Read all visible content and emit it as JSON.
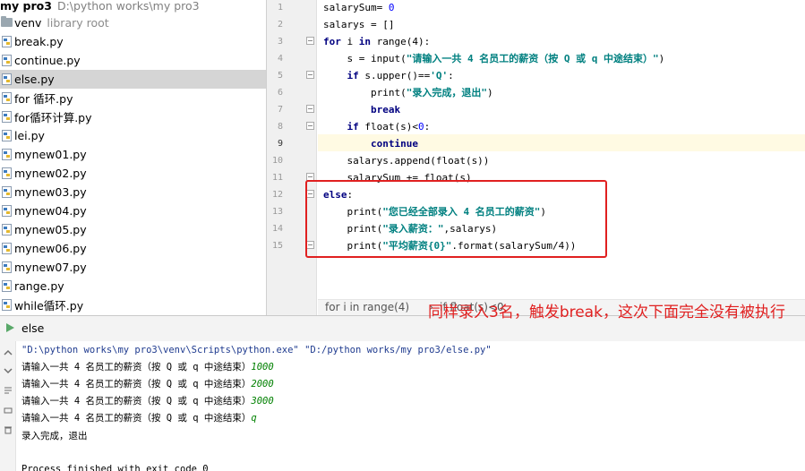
{
  "project": {
    "name": "my pro3",
    "path": "D:\\python works\\my pro3"
  },
  "tree": {
    "venv": {
      "label": "venv",
      "sub": "library root"
    },
    "files": [
      {
        "label": "break.py"
      },
      {
        "label": "continue.py"
      },
      {
        "label": "else.py",
        "selected": true
      },
      {
        "label": "for 循环.py"
      },
      {
        "label": "for循环计算.py"
      },
      {
        "label": "lei.py"
      },
      {
        "label": "mynew01.py"
      },
      {
        "label": "mynew02.py"
      },
      {
        "label": "mynew03.py"
      },
      {
        "label": "mynew04.py"
      },
      {
        "label": "mynew05.py"
      },
      {
        "label": "mynew06.py"
      },
      {
        "label": "mynew07.py"
      },
      {
        "label": "range.py"
      },
      {
        "label": "while循环.py"
      }
    ]
  },
  "editor": {
    "current_line": 9,
    "line_numbers": [
      "1",
      "2",
      "3",
      "4",
      "5",
      "6",
      "7",
      "8",
      "9",
      "10",
      "11",
      "12",
      "13",
      "14",
      "15"
    ]
  },
  "code": {
    "l1": {
      "a": "salarySum= ",
      "b": "0"
    },
    "l2": {
      "a": "salarys = []"
    },
    "l3": {
      "kw1": "for",
      "a": " i ",
      "kw2": "in",
      "b": " range(4):"
    },
    "l4": {
      "a": "    s = input(",
      "str": "\"请输入一共 4 名员工的薪资（按 Q 或 q 中途结束）\"",
      "b": ")"
    },
    "l5": {
      "kw": "    if",
      "a": " s.upper()==",
      "str": "'Q'",
      "b": ":"
    },
    "l6": {
      "a": "        print(",
      "str": "\"录入完成，退出\"",
      "b": ")"
    },
    "l7": {
      "kw": "        break"
    },
    "l8": {
      "kw": "    if",
      "a": " float(s)<",
      "num": "0",
      "b": ":"
    },
    "l9": {
      "kw": "        continue"
    },
    "l10": {
      "a": "    salarys.append(float(s))"
    },
    "l11": {
      "a": "    salarySum += float(s)"
    },
    "l12": {
      "kw": "else",
      "a": ":"
    },
    "l13": {
      "a": "    print(",
      "str": "\"您已经全部录入 4 名员工的薪资\"",
      "b": ")"
    },
    "l14": {
      "a": "    print(",
      "str": "\"录入薪资：\"",
      "b": ",salarys)"
    },
    "l15": {
      "a": "    print(",
      "str": "\"平均薪资{0}\"",
      "b": ".format(salarySum/4))"
    }
  },
  "breadcrumb": {
    "item1": "for i in range(4)",
    "item2": "if float(s)<0"
  },
  "run": {
    "tab_label": "else",
    "command": "\"D:\\python works\\my pro3\\venv\\Scripts\\python.exe\" \"D:/python works/my pro3/else.py\"",
    "prompt": "请输入一共 4 名员工的薪资（按 Q 或 q 中途结束）",
    "inputs": [
      "1000",
      "2000",
      "3000",
      "q"
    ],
    "done": "录入完成，退出",
    "exit": "Process finished with exit code 0"
  },
  "annotation": {
    "text": "同样录入3名，触发break，这次下面完全没有被执行"
  },
  "colors": {
    "keyword": "#000080",
    "string": "#008080",
    "number": "#0000ff",
    "annotation_red": "#e02020",
    "console_input": "#008000",
    "current_line_bg": "#fffae3",
    "selected_row_bg": "#d5d5d5"
  }
}
